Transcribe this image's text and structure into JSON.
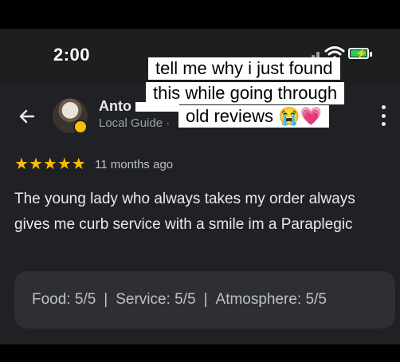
{
  "status_bar": {
    "time": "2:00"
  },
  "overlay_caption": {
    "line1": "tell me why i just found",
    "line2": "this while going through",
    "line3": "old reviews 😭💗"
  },
  "review": {
    "reviewer_name": "Anto",
    "reviewer_subtitle": "Local Guide · ",
    "rating_stars": 5,
    "time_ago": "11 months ago",
    "text": "The young lady who always takes my order always gives me curb service with a smile im a Paraplegic"
  },
  "ratings": {
    "food_label": "Food:",
    "food_value": "5/5",
    "service_label": "Service:",
    "service_value": "5/5",
    "atmosphere_label": "Atmosphere:",
    "atmosphere_value": "5/5",
    "separator": "|"
  },
  "icons": {
    "back": "arrow-left-icon",
    "more": "more-vertical-icon",
    "star": "star-icon"
  },
  "colors": {
    "background": "#202124",
    "star": "#fbbc04",
    "text_primary": "#e8eaed",
    "text_secondary": "#9aa0a6",
    "card": "#2e2f33",
    "battery": "#34c759"
  }
}
